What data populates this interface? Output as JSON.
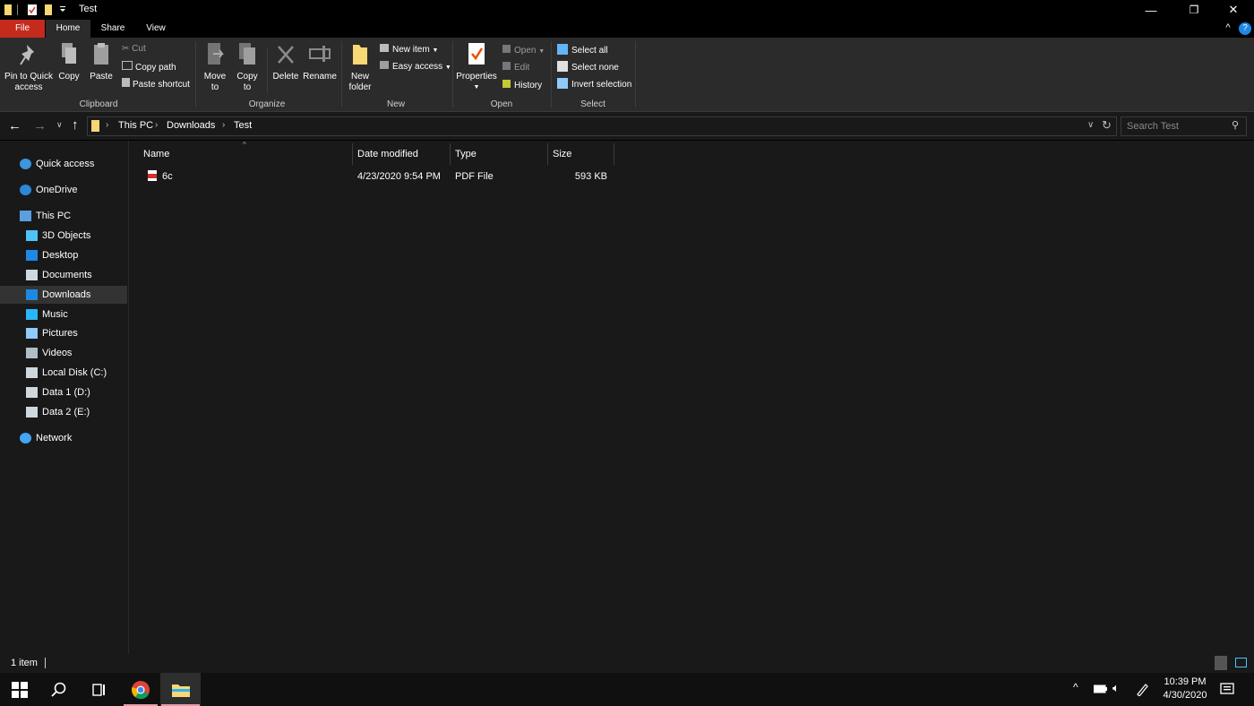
{
  "window": {
    "title": "Test",
    "controls": {
      "minimize": "—",
      "restore": "❐",
      "close": "✕"
    },
    "collapse_ribbon": "^",
    "help": "?"
  },
  "ribbon_tabs": [
    "File",
    "Home",
    "Share",
    "View"
  ],
  "ribbon": {
    "clipboard": {
      "label": "Clipboard",
      "pin_to_quick_access": "Pin to Quick access",
      "copy": "Copy",
      "paste": "Paste",
      "cut": "Cut",
      "copy_path": "Copy path",
      "paste_shortcut": "Paste shortcut"
    },
    "organize": {
      "label": "Organize",
      "move_to_line1": "Move",
      "move_to_line2": "to",
      "copy_to_line1": "Copy",
      "copy_to_line2": "to",
      "delete": "Delete",
      "rename": "Rename"
    },
    "new": {
      "label": "New",
      "new_folder_line1": "New",
      "new_folder_line2": "folder",
      "new_item": "New item",
      "easy_access": "Easy access"
    },
    "open": {
      "label": "Open",
      "properties": "Properties",
      "open": "Open",
      "edit": "Edit",
      "history": "History"
    },
    "select": {
      "label": "Select",
      "select_all": "Select all",
      "select_none": "Select none",
      "invert_selection": "Invert selection"
    }
  },
  "address": {
    "breadcrumbs": [
      "This PC",
      "Downloads",
      "Test"
    ],
    "search_placeholder": "Search Test"
  },
  "nav_pane": {
    "items": [
      {
        "label": "Quick access",
        "icon": "star-icon",
        "color": "#3a96dd"
      },
      {
        "label": "OneDrive",
        "icon": "cloud-icon",
        "color": "#2b88d8"
      },
      {
        "label": "This PC",
        "icon": "computer-icon",
        "color": "#5aa0e0"
      },
      {
        "label": "3D Objects",
        "icon": "cube-icon",
        "color": "#4fc3f7"
      },
      {
        "label": "Desktop",
        "icon": "desktop-icon",
        "color": "#1e88e5"
      },
      {
        "label": "Documents",
        "icon": "document-icon",
        "color": "#cfd8dc"
      },
      {
        "label": "Downloads",
        "icon": "download-arrow-icon",
        "color": "#1e88e5"
      },
      {
        "label": "Music",
        "icon": "music-note-icon",
        "color": "#29b6f6"
      },
      {
        "label": "Pictures",
        "icon": "picture-icon",
        "color": "#90caf9"
      },
      {
        "label": "Videos",
        "icon": "film-icon",
        "color": "#b0bec5"
      },
      {
        "label": "Local Disk (C:)",
        "icon": "drive-icon",
        "color": "#cfd8dc"
      },
      {
        "label": "Data 1 (D:)",
        "icon": "drive-icon",
        "color": "#cfd8dc"
      },
      {
        "label": "Data 2 (E:)",
        "icon": "drive-icon",
        "color": "#cfd8dc"
      },
      {
        "label": "Network",
        "icon": "network-icon",
        "color": "#42a5f5"
      }
    ],
    "selected": "Downloads"
  },
  "file_list": {
    "columns": [
      "Name",
      "Date modified",
      "Type",
      "Size"
    ],
    "rows": [
      {
        "name": "6c",
        "date_modified": "4/23/2020 9:54 PM",
        "type": "PDF File",
        "size": "593 KB",
        "icon": "pdf-file-icon"
      }
    ]
  },
  "status": {
    "item_count": "1 item"
  },
  "taskbar": {
    "time": "10:39 PM",
    "date": "4/30/2020",
    "apps": [
      "start-icon",
      "search-icon",
      "task-view-icon",
      "chrome-icon",
      "file-explorer-icon"
    ]
  },
  "colors": {
    "file_tab": "#c42b1c",
    "accent": "#0078d7",
    "folder": "#f8d775",
    "background": "#191919",
    "ribbon": "#2b2b2b"
  }
}
